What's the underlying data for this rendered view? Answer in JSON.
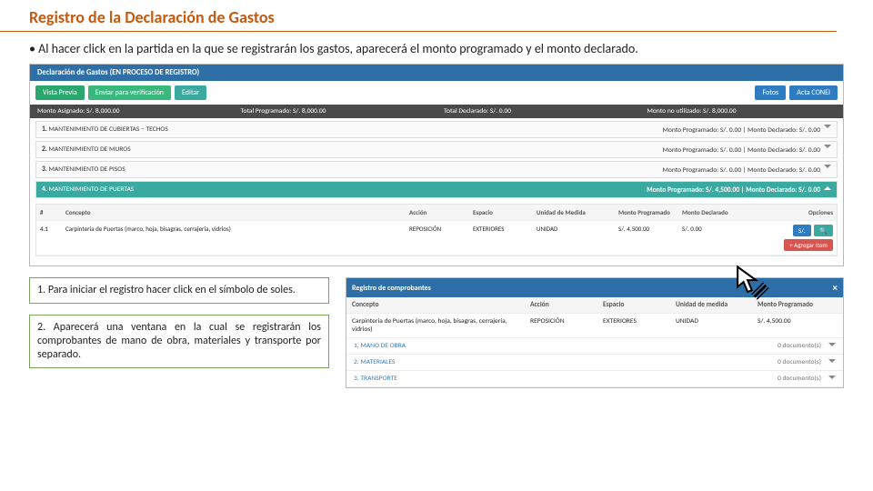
{
  "title": "Registro de la Declaración de Gastos",
  "bullet": "Al hacer click en la partida en la que se registrarán los gastos, aparecerá el monto programado y el monto declarado.",
  "panel": {
    "header": "Declaración de Gastos (EN PROCESO DE REGISTRO)",
    "buttons": {
      "vista": "Vista Previa",
      "enviar": "Enviar para verificación",
      "editar": "Editar",
      "fotos": "Fotos",
      "acta": "Acta CONEI"
    },
    "summary": {
      "asignado": "Monto Asignado: S/. 8,000.00",
      "programado": "Total Programado: S/. 8,000.00",
      "declarado": "Total Declarado: S/. 0.00",
      "noutil": "Monto no utilizado: S/. 8,000.00"
    },
    "partidas": [
      {
        "n": "1.",
        "t": "MANTENIMIENTO DE CUBIERTAS – TECHOS",
        "r": "Monto Programado: S/. 0.00 | Monto Declarado: S/. 0.00"
      },
      {
        "n": "2.",
        "t": "MANTENIMIENTO DE MUROS",
        "r": "Monto Programado: S/. 0.00 | Monto Declarado: S/. 0.00"
      },
      {
        "n": "3.",
        "t": "MANTENIMIENTO DE PISOS",
        "r": "Monto Programado: S/. 0.00 | Monto Declarado: S/. 0.00"
      },
      {
        "n": "4.",
        "t": "MANTENIMIENTO DE PUERTAS",
        "r": "Monto Programado: S/. 4,500.00 | Monto Declarado: S/. 0.00"
      }
    ],
    "table": {
      "headers": {
        "n": "#",
        "con": "Concepto",
        "acc": "Acción",
        "esp": "Espacio",
        "um": "Unidad de Medida",
        "mp": "Monto Programado",
        "md": "Monto Declarado",
        "op": "Opciones"
      },
      "row": {
        "n": "4.1",
        "con": "Carpintería de Puertas (marco, hoja, bisagras, cerrajería, vidrios)",
        "acc": "REPOSICIÓN",
        "esp": "EXTERIORES",
        "um": "UNIDAD",
        "mp": "S/. 4,500.00",
        "md": "S/. 0.00"
      },
      "ops": {
        "view": "🔍",
        "add": "+ Agregar Item"
      }
    }
  },
  "notes": {
    "n1": "1. Para iniciar el registro hacer click en el símbolo de soles.",
    "n2": "2. Aparecerá una ventana en la cual se registrarán los comprobantes de mano de obra, materiales y transporte por separado."
  },
  "modal": {
    "title": "Registro de comprobantes",
    "headers": {
      "con": "Concepto",
      "acc": "Acción",
      "esp": "Espacio",
      "um": "Unidad de medida",
      "mp": "Monto Programado"
    },
    "row": {
      "con": "Carpintería de Puertas (marco, hoja, bisagras, cerrajería, vidrios)",
      "acc": "REPOSICIÓN",
      "esp": "EXTERIORES",
      "um": "UNIDAD",
      "mp": "S/. 4,500.00"
    },
    "cats": [
      {
        "t": "1. MANO DE OBRA",
        "d": "0 documento(s)"
      },
      {
        "t": "2. MATERIALES",
        "d": "0 documento(s)"
      },
      {
        "t": "3. TRANSPORTE",
        "d": "0 documento(s)"
      }
    ]
  }
}
